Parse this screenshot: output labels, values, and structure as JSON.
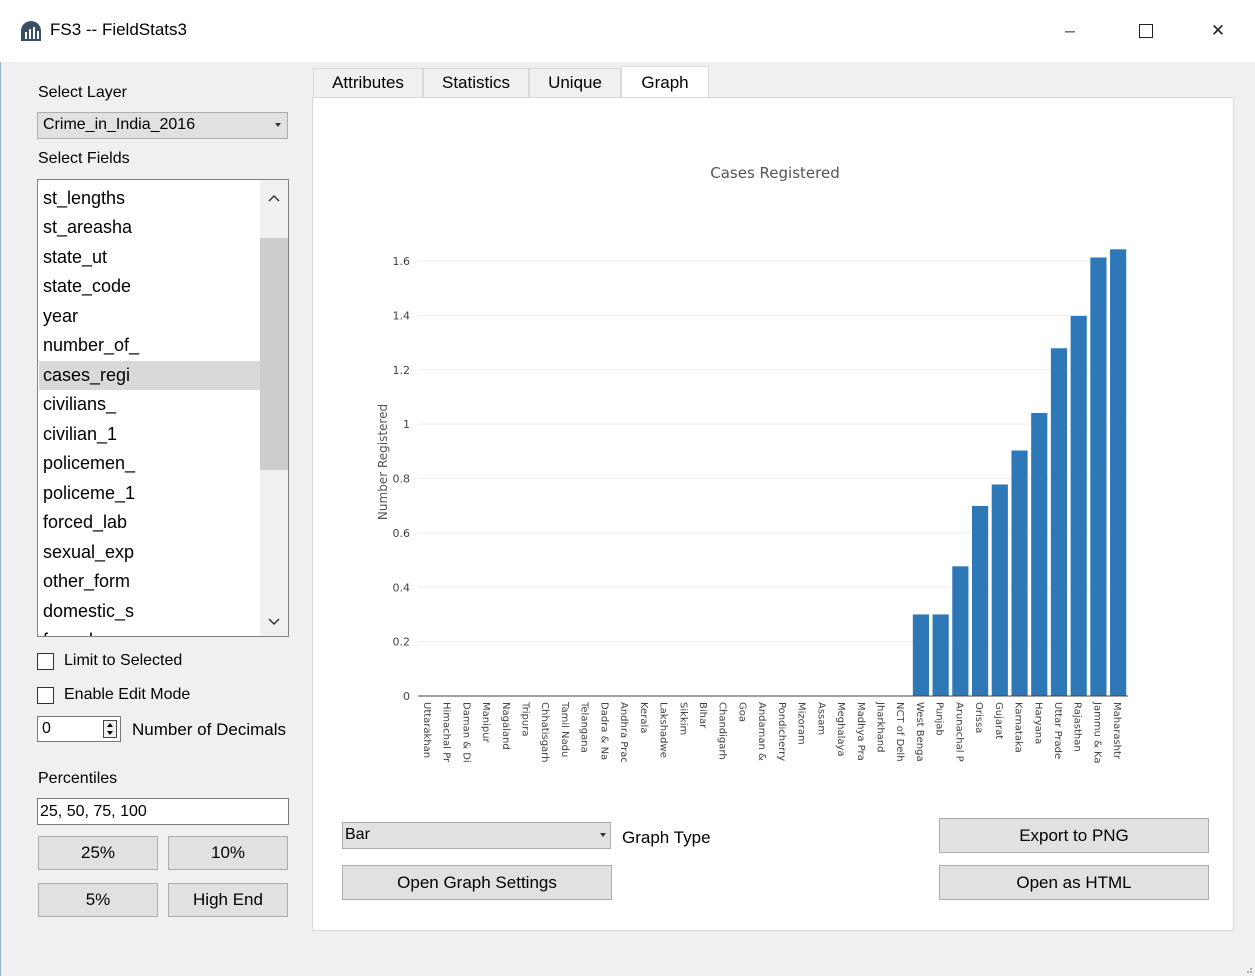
{
  "window": {
    "title": "FS3 -- FieldStats3",
    "minimize_glyph": "─",
    "close_glyph": "✕"
  },
  "left": {
    "select_layer_label": "Select Layer",
    "layer_value": "Crime_in_India_2016",
    "select_fields_label": "Select Fields",
    "fields": [
      "st_lengths",
      "st_areasha",
      "state_ut",
      "state_code",
      "year",
      "number_of_",
      "cases_regi",
      "civilians_",
      "civilian_1",
      "policemen_",
      "policeme_1",
      "forced_lab",
      "sexual_exp",
      "other_form",
      "domestic_s",
      "forced_m"
    ],
    "selected_field": "cases_regi",
    "limit_label": "Limit to Selected",
    "edit_label": "Enable Edit Mode",
    "decimals_value": "0",
    "decimals_label": "Number of Decimals",
    "percentiles_label": "Percentiles",
    "percentiles_value": "25, 50, 75, 100",
    "btn_25": "25%",
    "btn_10": "10%",
    "btn_5": "5%",
    "btn_high": "High End"
  },
  "tabs": [
    "Attributes",
    "Statistics",
    "Unique",
    "Graph"
  ],
  "active_tab": "Graph",
  "graph": {
    "type_value": "Bar",
    "type_label": "Graph Type",
    "open_settings": "Open Graph Settings",
    "export_png": "Export to PNG",
    "open_html": "Open as HTML",
    "bar_color": "#2e78b8"
  },
  "chart_data": {
    "type": "bar",
    "title": "Cases Registered",
    "xlabel": "",
    "ylabel": "Number Registered",
    "ylim": [
      0,
      1.65
    ],
    "yticks": [
      0,
      0.2,
      0.4,
      0.6,
      0.8,
      1,
      1.2,
      1.4,
      1.6
    ],
    "grid": true,
    "categories": [
      "Uttarakhan",
      "Himachal Pr",
      "Daman & Di",
      "Manipur",
      "Nagaland",
      "Tripura",
      "Chhatisgarh",
      "Tamil Nadu",
      "Telangana",
      "Dadra & Na",
      "Andhra Prac",
      "Kerala",
      "Lakshadwe",
      "Sikkim",
      "Bihar",
      "Chandigarh",
      "Goa",
      "Andaman &",
      "Pondicherry",
      "Mizoram",
      "Assam",
      "Meghalaya",
      "Madhya Pra",
      "Jharkhand",
      "NCT of Delh",
      "West Benga",
      "Punjab",
      "Arunachal P",
      "Orissa",
      "Gujarat",
      "Karnataka",
      "Haryana",
      "Uttar Prade",
      "Rajasthan",
      "Jammu & Ka",
      "Maharashtr"
    ],
    "values": [
      0,
      0,
      0,
      0,
      0,
      0,
      0,
      0,
      0,
      0,
      0,
      0,
      0,
      0,
      0,
      0,
      0,
      0,
      0,
      0,
      0,
      0,
      0,
      0,
      0,
      0.3,
      0.3,
      0.477,
      0.699,
      0.778,
      0.903,
      1.041,
      1.279,
      1.398,
      1.613,
      1.643
    ]
  }
}
